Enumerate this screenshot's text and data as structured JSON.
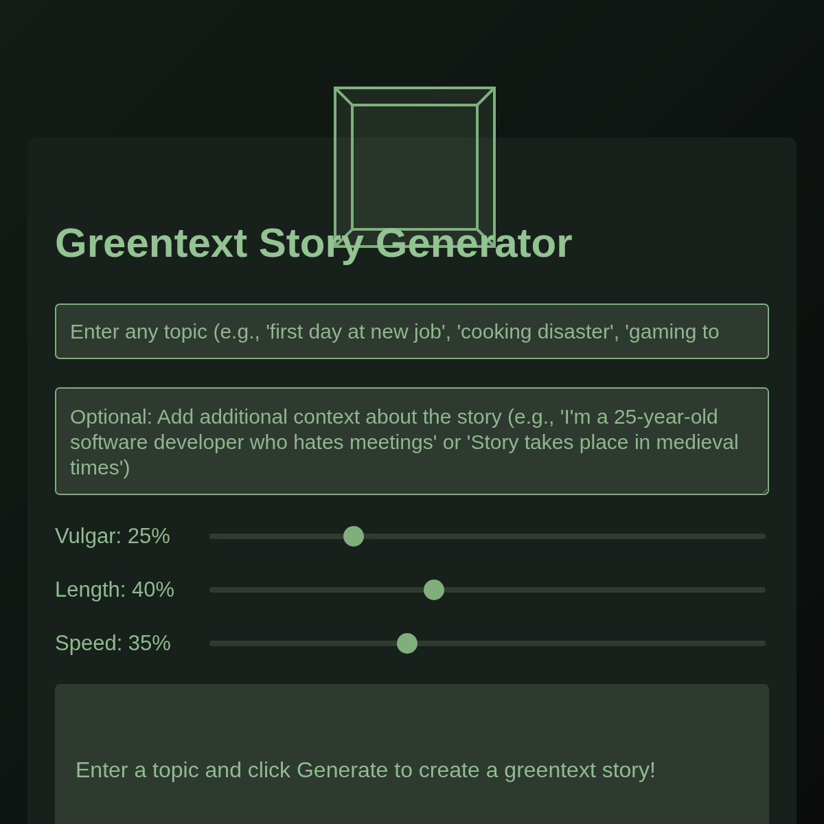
{
  "title": "Greentext Story Generator",
  "topic_field": {
    "placeholder": "Enter any topic (e.g., 'first day at new job', 'cooking disaster', 'gaming to"
  },
  "context_field": {
    "placeholder": "Optional: Add additional context about the story (e.g., 'I'm a 25-year-old software developer who hates meetings' or 'Story takes place in medieval times')"
  },
  "sliders": [
    {
      "label": "Vulgar: 25%",
      "level": 0.25
    },
    {
      "label": "Length: 40%",
      "level": 0.4
    },
    {
      "label": "Speed: 35%",
      "level": 0.35
    }
  ],
  "output": {
    "text": "Enter a topic and click Generate to create a greentext story!"
  }
}
